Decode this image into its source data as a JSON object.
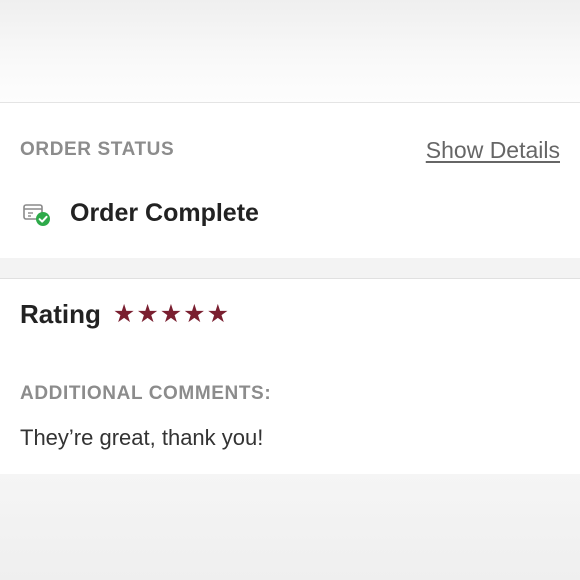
{
  "order_status": {
    "section_label": "ORDER STATUS",
    "show_details_label": "Show Details",
    "status_text": "Order Complete",
    "status_icon": "package-check-icon"
  },
  "rating": {
    "label": "Rating",
    "stars": 5,
    "max_stars": 5,
    "star_color": "#7a1f30"
  },
  "comments": {
    "section_label": "ADDITIONAL COMMENTS:",
    "text": "They’re great, thank you!"
  }
}
